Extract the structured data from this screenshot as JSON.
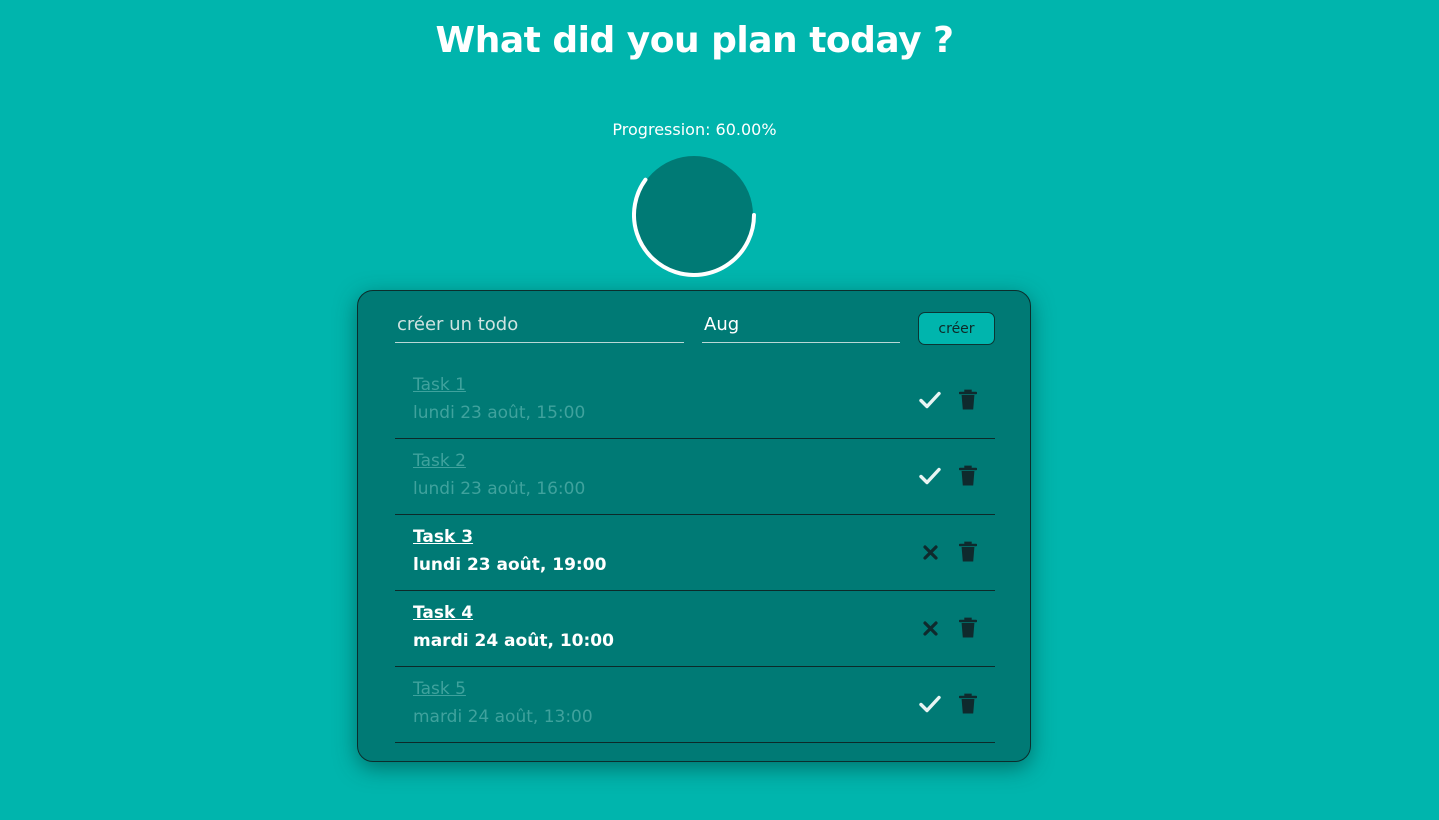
{
  "header": {
    "title": "What did you plan today ?"
  },
  "progress": {
    "label": "Progression: 60.00%",
    "value": 0.6
  },
  "form": {
    "todo_placeholder": "créer un todo",
    "date_value": "Aug",
    "create_label": "créer"
  },
  "todos": [
    {
      "name": "Task 1",
      "date": "lundi 23 août, 15:00",
      "done": true,
      "action_icon": "check-icon"
    },
    {
      "name": "Task 2",
      "date": "lundi 23 août, 16:00",
      "done": true,
      "action_icon": "check-icon"
    },
    {
      "name": "Task 3",
      "date": "lundi 23 août, 19:00",
      "done": false,
      "action_icon": "close-icon"
    },
    {
      "name": "Task 4",
      "date": "mardi 24 août, 10:00",
      "done": false,
      "action_icon": "close-icon"
    },
    {
      "name": "Task 5",
      "date": "mardi 24 août, 13:00",
      "done": true,
      "action_icon": "check-icon"
    }
  ],
  "colors": {
    "background": "#00b5ad",
    "card": "#007a75",
    "ring_fill": "#007a75",
    "ring_stroke": "#ffffff",
    "icon_dark": "#0f2a2d",
    "icon_light": "#e8f4f3",
    "done_text": "#3fa29d"
  },
  "icons": {
    "delete": "trash-icon"
  }
}
